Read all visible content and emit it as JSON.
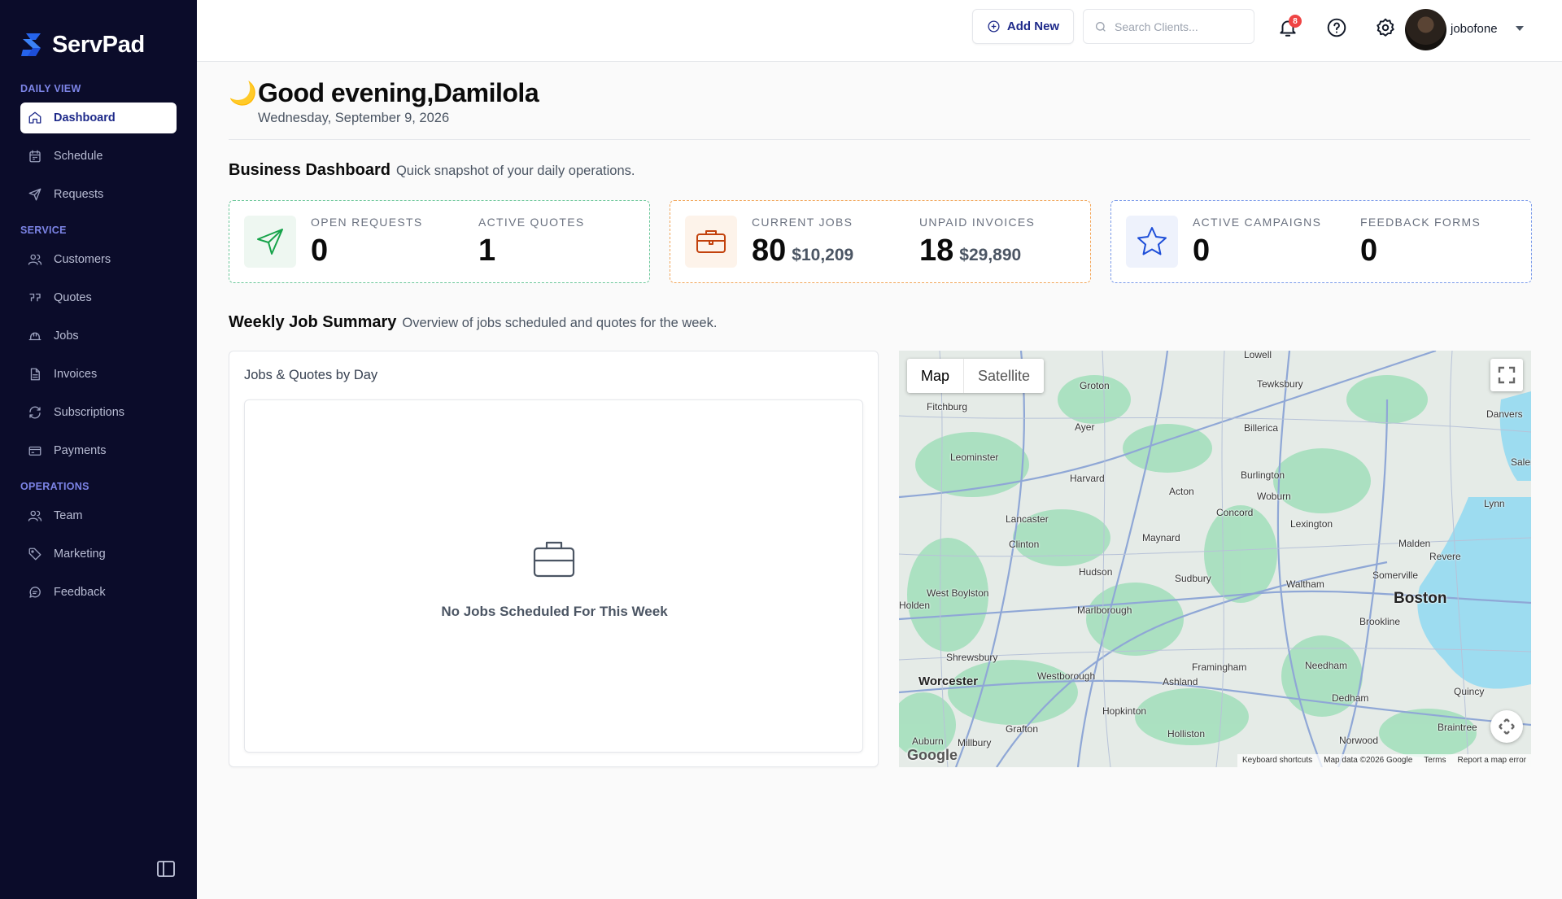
{
  "brand": {
    "name": "ServPad"
  },
  "sidebar": {
    "sections": [
      {
        "title": "DAILY VIEW",
        "items": [
          {
            "label": "Dashboard",
            "icon": "home-icon",
            "active": true
          },
          {
            "label": "Schedule",
            "icon": "calendar-icon"
          },
          {
            "label": "Requests",
            "icon": "send-icon"
          }
        ]
      },
      {
        "title": "SERVICE",
        "items": [
          {
            "label": "Customers",
            "icon": "users-icon"
          },
          {
            "label": "Quotes",
            "icon": "quote-icon"
          },
          {
            "label": "Jobs",
            "icon": "hard-hat-icon"
          },
          {
            "label": "Invoices",
            "icon": "file-icon"
          },
          {
            "label": "Subscriptions",
            "icon": "refresh-icon"
          },
          {
            "label": "Payments",
            "icon": "credit-card-icon"
          }
        ]
      },
      {
        "title": "OPERATIONS",
        "items": [
          {
            "label": "Team",
            "icon": "users-icon"
          },
          {
            "label": "Marketing",
            "icon": "tag-icon"
          },
          {
            "label": "Feedback",
            "icon": "message-icon"
          }
        ]
      }
    ]
  },
  "topbar": {
    "add_new_label": "Add New",
    "search_placeholder": "Search Clients...",
    "notification_count": "8",
    "username": "jobofone"
  },
  "greeting": {
    "emoji": "🌙",
    "text": "Good evening,Damilola",
    "date": "Wednesday, September 9, 2026"
  },
  "business_dashboard": {
    "title": "Business Dashboard",
    "subtitle": "Quick snapshot of your daily operations.",
    "cards": [
      {
        "color": "#16a34a",
        "icon": "send-icon",
        "stats": [
          {
            "label": "OPEN REQUESTS",
            "value": "0",
            "amount": ""
          },
          {
            "label": "ACTIVE QUOTES",
            "value": "1",
            "amount": ""
          }
        ]
      },
      {
        "color": "#c2410c",
        "icon": "briefcase-icon",
        "stats": [
          {
            "label": "CURRENT JOBS",
            "value": "80",
            "amount": "$10,209"
          },
          {
            "label": "UNPAID INVOICES",
            "value": "18",
            "amount": "$29,890"
          }
        ]
      },
      {
        "color": "#1d4ed8",
        "icon": "star-icon",
        "stats": [
          {
            "label": "ACTIVE CAMPAIGNS",
            "value": "0",
            "amount": ""
          },
          {
            "label": "FEEDBACK FORMS",
            "value": "0",
            "amount": ""
          }
        ]
      }
    ]
  },
  "weekly_summary": {
    "title": "Weekly Job Summary",
    "subtitle": "Overview of jobs scheduled and quotes for the week.",
    "panel_title": "Jobs & Quotes by Day",
    "empty_text": "No Jobs Scheduled For This Week"
  },
  "map": {
    "type_buttons": [
      "Map",
      "Satellite"
    ],
    "places": [
      "Lowell",
      "Groton",
      "Tewksbury",
      "Fitchburg",
      "Danvers",
      "Ayer",
      "Billerica",
      "Leominster",
      "Harvard",
      "Burlington",
      "Saler",
      "Acton",
      "Woburn",
      "Lynn",
      "Concord",
      "Lexington",
      "Lancaster",
      "Clinton",
      "Maynard",
      "Malden",
      "Revere",
      "Hudson",
      "Sudbury",
      "Somerville",
      "West Boylston",
      "Waltham",
      "Boston",
      "Marlborough",
      "Brookline",
      "Holden",
      "Shrewsbury",
      "Framingham",
      "Needham",
      "Worcester",
      "Westborough",
      "Ashland",
      "Quincy",
      "Dedham",
      "Hopkinton",
      "Braintree",
      "Grafton",
      "Holliston",
      "Norwood",
      "Auburn",
      "Millbury"
    ],
    "footer": [
      "Keyboard shortcuts",
      "Map data ©2026 Google",
      "Terms",
      "Report a map error"
    ],
    "logo": "Google"
  }
}
